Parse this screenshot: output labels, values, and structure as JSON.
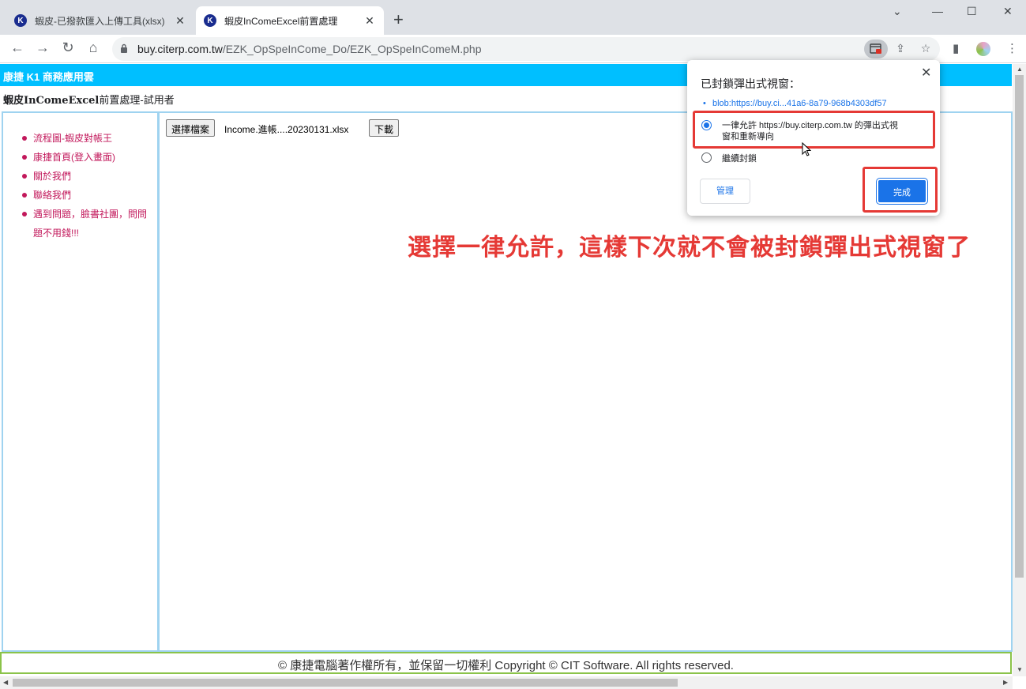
{
  "browser": {
    "tabs": [
      {
        "title": "蝦皮-已撥款匯入上傳工具(xlsx)",
        "active": false
      },
      {
        "title": "蝦皮InComeExcel前置處理",
        "active": true
      }
    ],
    "favicon_letter": "K",
    "new_tab": "+",
    "url_host": "buy.citerp.com.tw",
    "url_path": "/EZK_OpSpeInCome_Do/EZK_OpSpeInComeM.php"
  },
  "page": {
    "header": "康捷 K1 商務應用雲",
    "subtitle_bold": "蝦皮InComeExcel",
    "subtitle_rest": "前置處理-試用者",
    "sidebar": [
      {
        "label": "流程圖-蝦皮對帳王"
      },
      {
        "label": "康捷首頁(登入畫面)"
      },
      {
        "label": "關於我們"
      },
      {
        "label": "聯絡我們"
      },
      {
        "label": "遇到問題，臉書社團，問問"
      },
      {
        "label": "題不用錢!!!"
      }
    ],
    "choose_file_label": "選擇檔案",
    "file_name": "Income.進帳....20230131.xlsx",
    "download_label": "下載",
    "annotation": "選擇一律允許，這樣下次就不會被封鎖彈出式視窗了",
    "footer": "© 康捷電腦著作權所有，並保留一切權利 Copyright © CIT Software. All rights reserved."
  },
  "popup_dialog": {
    "title": "已封鎖彈出式視窗：",
    "blocked_link": "blob:https://buy.ci...41a6-8a79-968b4303df57",
    "option_allow": "一律允許 https://buy.citerp.com.tw 的彈出式視窗和重新導向",
    "option_allow_line1": "一律允許 https://buy.citerp.com.tw 的彈出式視",
    "option_allow_line2": "窗和重新導向",
    "option_block": "繼續封鎖",
    "selected": "allow",
    "manage_label": "管理",
    "done_label": "完成"
  },
  "colors": {
    "header_bg": "#00bfff",
    "panel_border": "#9fd3f0",
    "sidebar_link": "#c2185b",
    "footer_border": "#8bc34a",
    "annotation": "#e53935",
    "accent": "#1a73e8"
  }
}
